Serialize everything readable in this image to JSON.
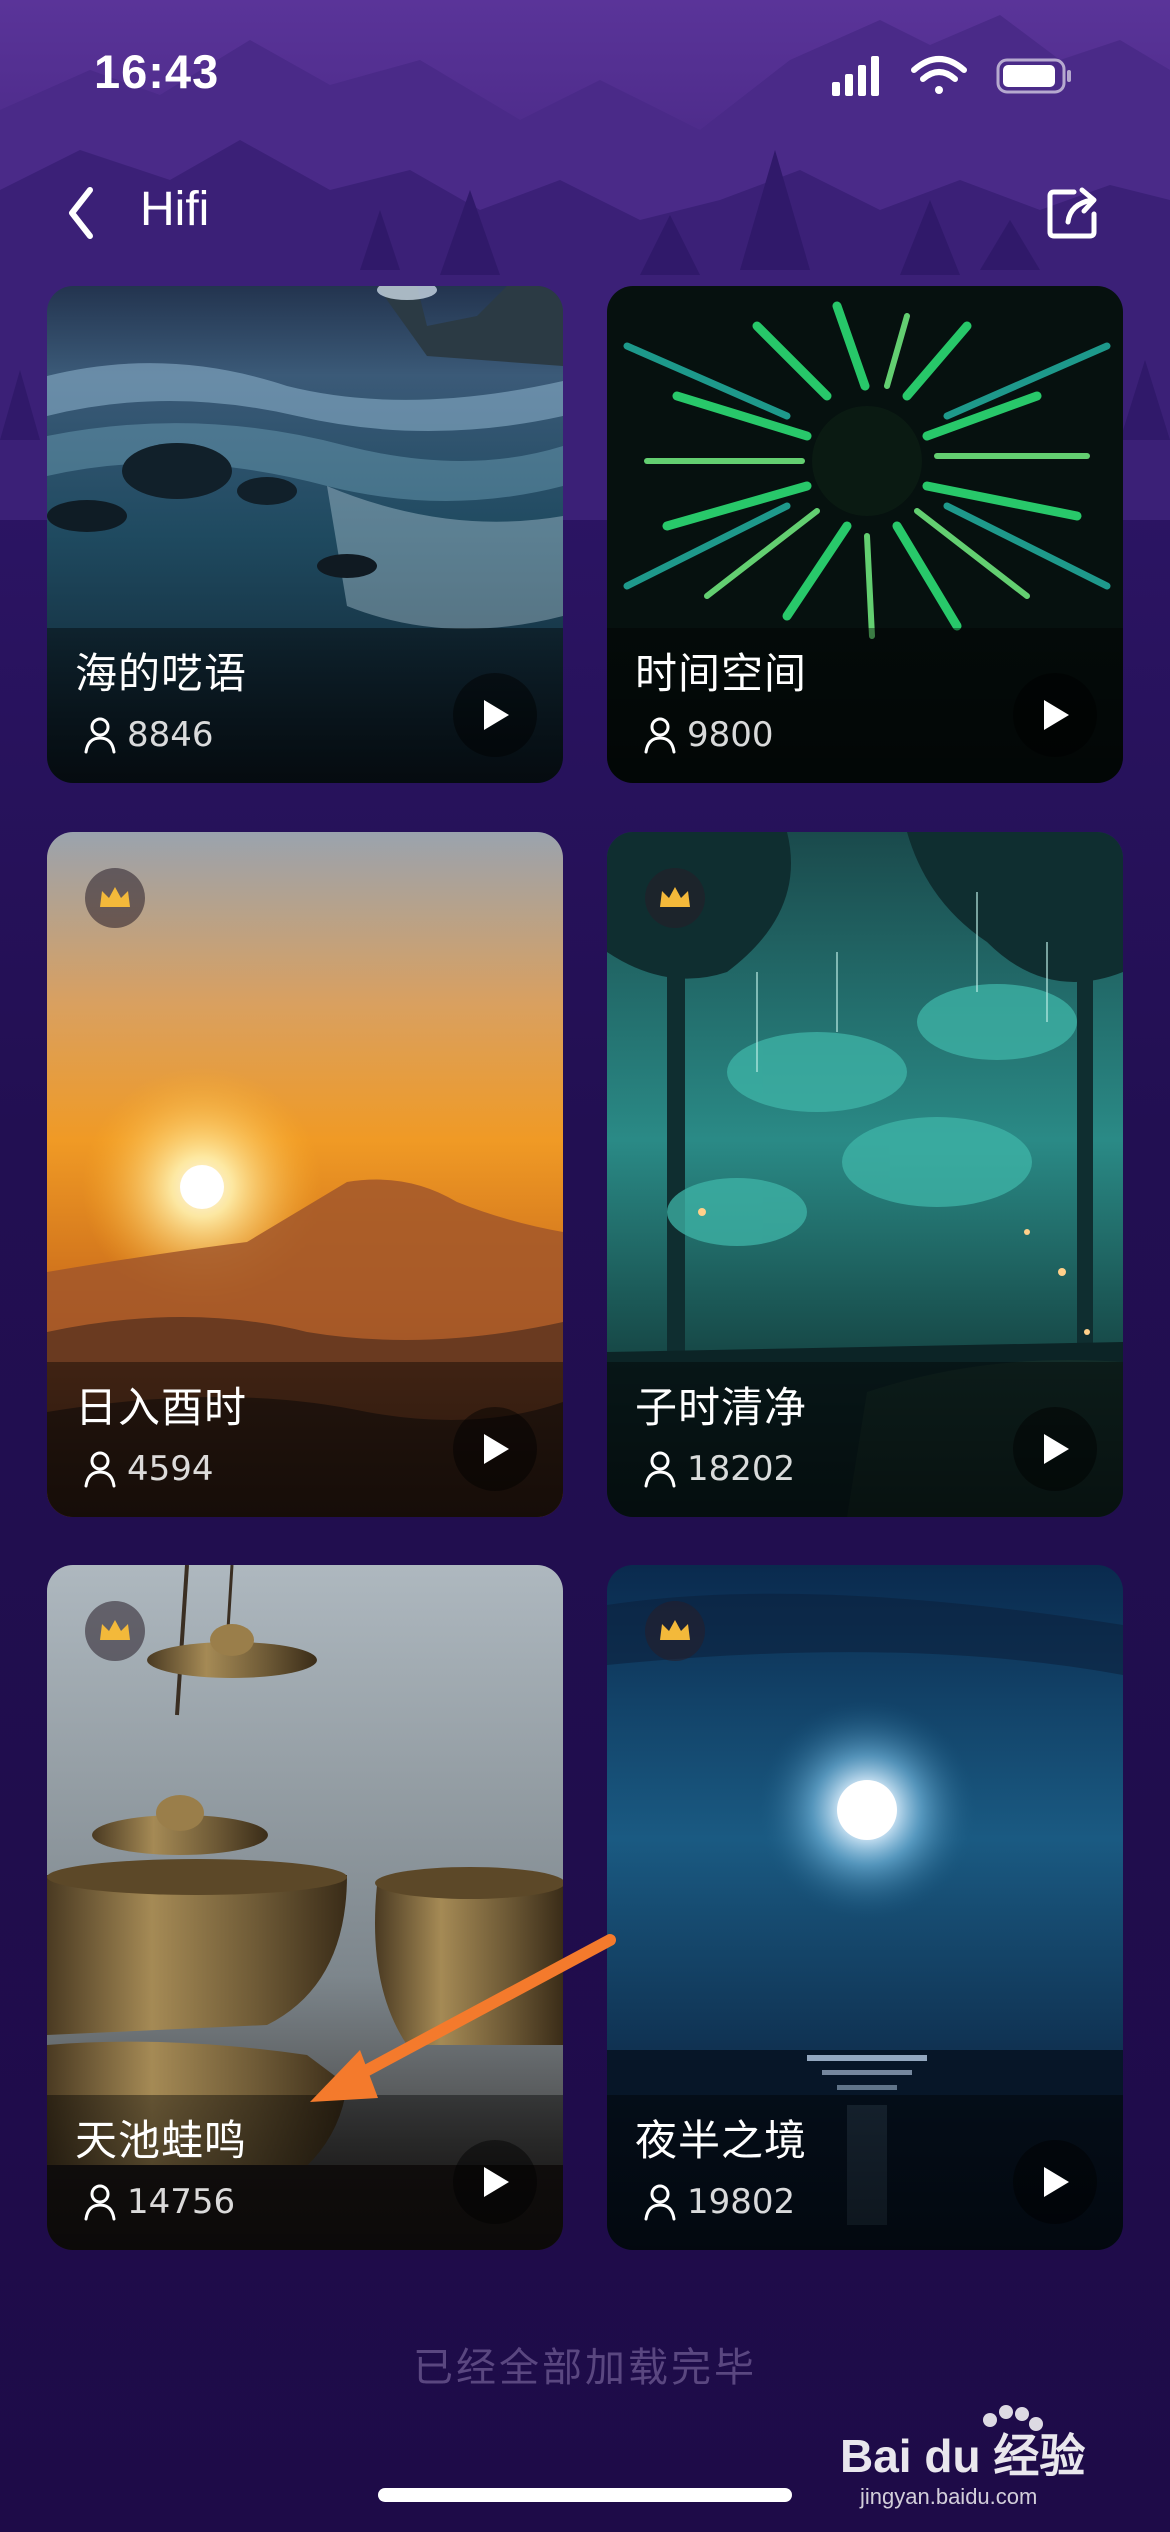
{
  "status_bar": {
    "time": "16:43"
  },
  "nav": {
    "title": "Hifi",
    "back_icon": "chevron-left-icon",
    "share_icon": "share-icon"
  },
  "cards": [
    {
      "title": "海的呓语",
      "plays": "8846",
      "premium": false,
      "scene": "sea-shore"
    },
    {
      "title": "时间空间",
      "plays": "9800",
      "premium": false,
      "scene": "green-tunnel"
    },
    {
      "title": "日入酉时",
      "plays": "4594",
      "premium": true,
      "scene": "sunset-mountain"
    },
    {
      "title": "子时清净",
      "plays": "18202",
      "premium": true,
      "scene": "teal-forest"
    },
    {
      "title": "天池蛙鸣",
      "plays": "14756",
      "premium": true,
      "scene": "singing-bowls"
    },
    {
      "title": "夜半之境",
      "plays": "19802",
      "premium": true,
      "scene": "moon-sea"
    }
  ],
  "footer": {
    "end_text": "已经全部加载完毕"
  },
  "watermark": {
    "text": "Bai du 经验",
    "url": "jingyan.baidu.com"
  },
  "colors": {
    "background": "#220f52",
    "crown": "#f3b93a",
    "annotation_arrow": "#f47a2c"
  }
}
